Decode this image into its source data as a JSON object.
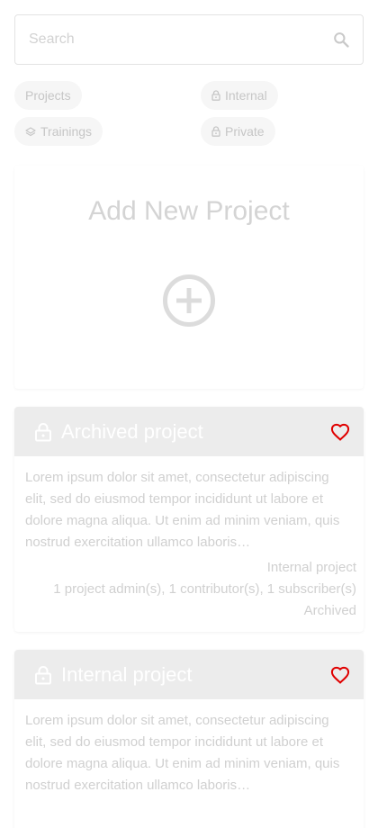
{
  "search": {
    "placeholder": "Search"
  },
  "filters": [
    {
      "label": "Projects",
      "icon": "none"
    },
    {
      "label": "Internal",
      "icon": "lock-icon"
    },
    {
      "label": "Trainings",
      "icon": "layers-icon"
    },
    {
      "label": "Private",
      "icon": "lock-icon"
    }
  ],
  "add_project": {
    "title": "Add New Project",
    "icon": "add-circle-icon"
  },
  "projects": [
    {
      "title": "Archived project",
      "description": "Lorem ipsum dolor sit amet, consectetur adipiscing elit, sed do eiusmod tempor incididunt ut labore et dolore magna aliqua. Ut enim ad minim veniam, quis nostrud exercitation ullamco laboris…",
      "type": "Internal project",
      "members": "1 project admin(s), 1 contributor(s), 1 subscriber(s)",
      "status": "Archived",
      "favorite_color": "#e00000"
    },
    {
      "title": "Internal project",
      "description": "Lorem ipsum dolor sit amet, consectetur adipiscing elit, sed do eiusmod tempor incididunt ut labore et dolore magna aliqua. Ut enim ad minim veniam, quis nostrud exercitation ullamco laboris…",
      "favorite_color": "#e00000"
    }
  ]
}
